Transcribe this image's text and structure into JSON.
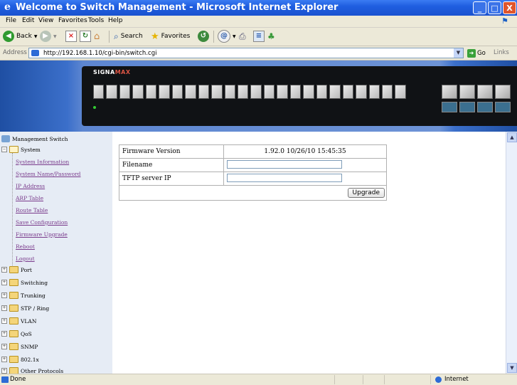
{
  "window": {
    "title": "Welcome to Switch Management - Microsoft Internet Explorer",
    "minimize": "_",
    "maximize": "□",
    "close": "X"
  },
  "menu": [
    "File",
    "Edit",
    "View",
    "Favorites",
    "Tools",
    "Help"
  ],
  "toolbar": {
    "back_label": "Back",
    "search_label": "Search",
    "favorites_label": "Favorites"
  },
  "address": {
    "label": "Address",
    "url": "http://192.168.1.10/cgi-bin/switch.cgi",
    "go_label": "Go",
    "links_label": "Links"
  },
  "banner": {
    "brand_main": "SIGNA",
    "brand_accent": "MAX"
  },
  "sidebar": {
    "root": "Management Switch",
    "system": "System",
    "system_links": [
      "System Information",
      "System Name/Password",
      "IP Address",
      "ARP Table",
      "Route Table",
      "Save Configuration",
      "Firmware Upgrade",
      "Reboot",
      "Logout"
    ],
    "folders": [
      "Port",
      "Switching",
      "Trunking",
      "STP / Ring",
      "VLAN",
      "QoS",
      "SNMP",
      "802.1x",
      "Other Protocols"
    ]
  },
  "firmware": {
    "version_label": "Firmware Version",
    "version_value": "1.92.0 10/26/10 15:45:35",
    "filename_label": "Filename",
    "filename_value": "",
    "tftp_label": "TFTP server IP",
    "tftp_value": "",
    "upgrade_button": "Upgrade"
  },
  "status": {
    "text": "Done",
    "zone": "Internet"
  }
}
